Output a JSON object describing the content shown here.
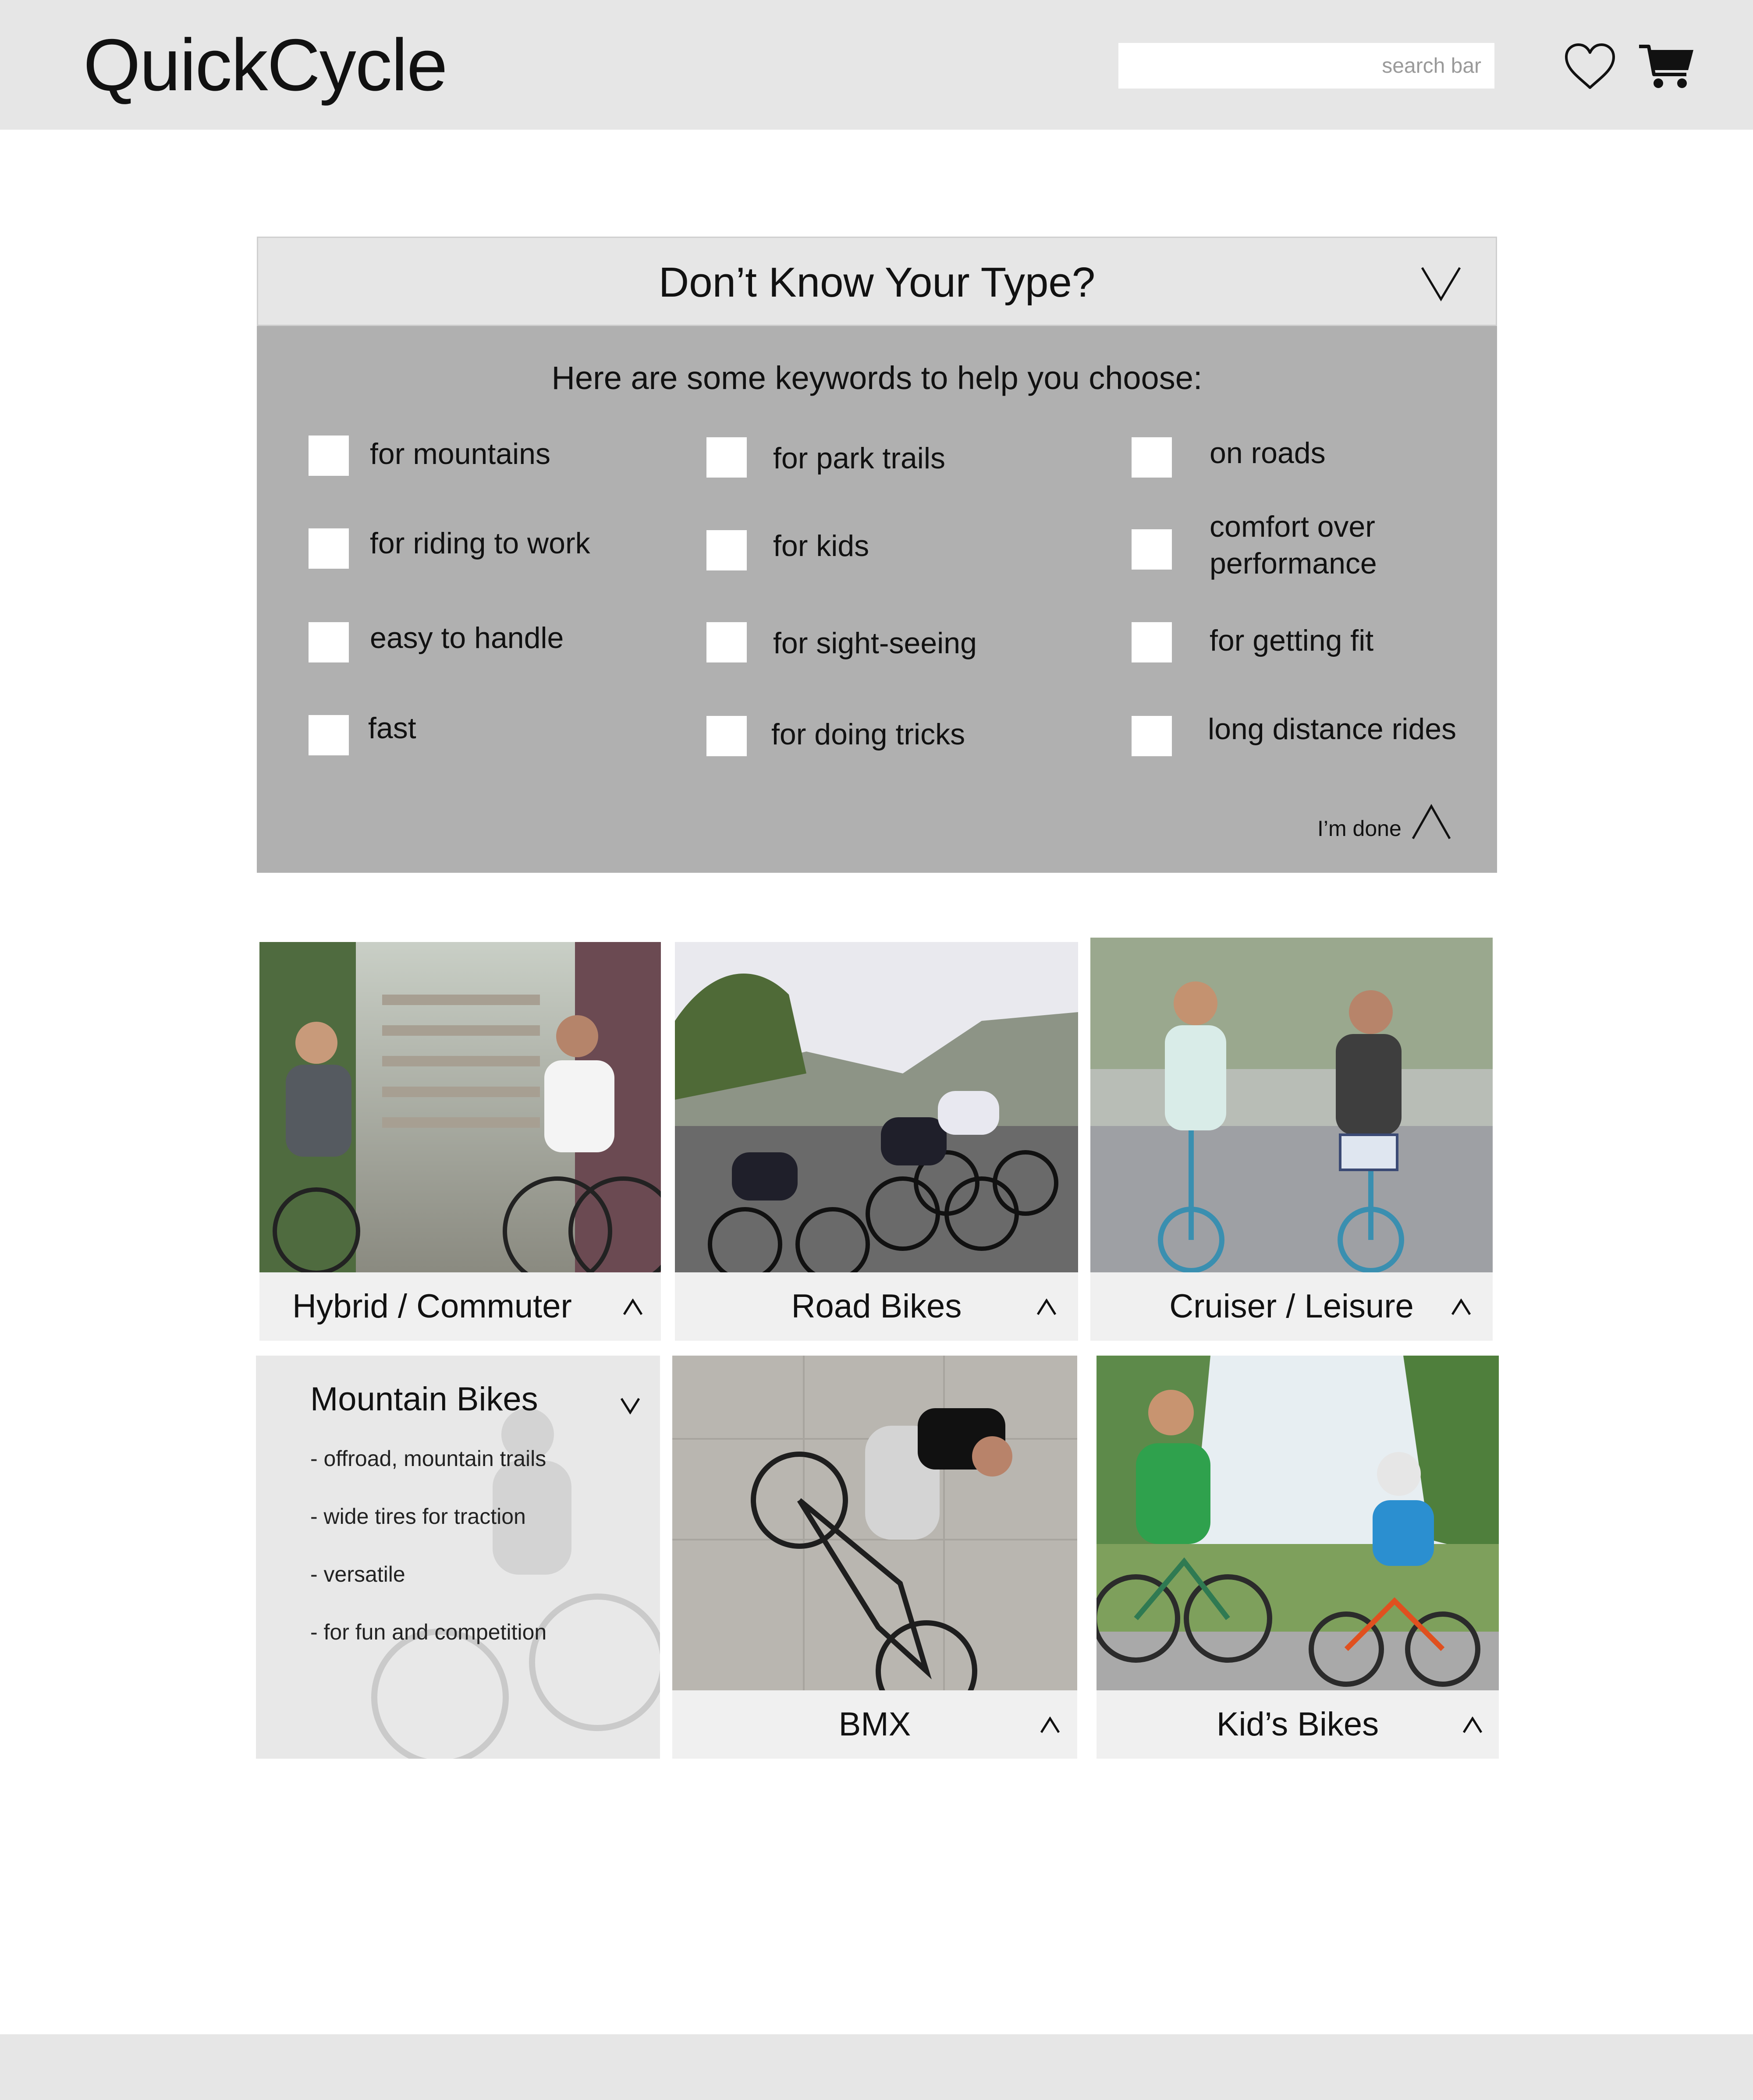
{
  "header": {
    "logo": "QuickCycle",
    "search_placeholder": "search bar",
    "icons": [
      "heart-icon",
      "cart-icon"
    ]
  },
  "quiz": {
    "title": "Don’t Know Your Type?",
    "subtitle": "Here are some keywords to help you choose:",
    "options": [
      "for mountains",
      "for park trails",
      "on roads",
      "for riding to work",
      "for kids",
      "comfort over performance",
      "easy to handle",
      "for sight-seeing",
      "for getting fit",
      "fast",
      "for doing tricks",
      "long distance rides"
    ],
    "done_label": "I’m done"
  },
  "categories": [
    {
      "label": "Hybrid / Commuter",
      "state": "collapsed"
    },
    {
      "label": "Road Bikes",
      "state": "collapsed"
    },
    {
      "label": "Cruiser / Leisure",
      "state": "collapsed"
    },
    {
      "label": "Mountain Bikes",
      "state": "expanded",
      "details": [
        "- offroad, mountain trails",
        "- wide tires for traction",
        "- versatile",
        "- for fun and competition"
      ]
    },
    {
      "label": "BMX",
      "state": "collapsed"
    },
    {
      "label": "Kid’s Bikes",
      "state": "collapsed"
    }
  ],
  "colors": {
    "header_bg": "#e6e6e6",
    "quiz_body_bg": "#b0b0b0",
    "card_bar_bg": "#f0f0f0",
    "footer_bg": "#e6e6e6"
  }
}
